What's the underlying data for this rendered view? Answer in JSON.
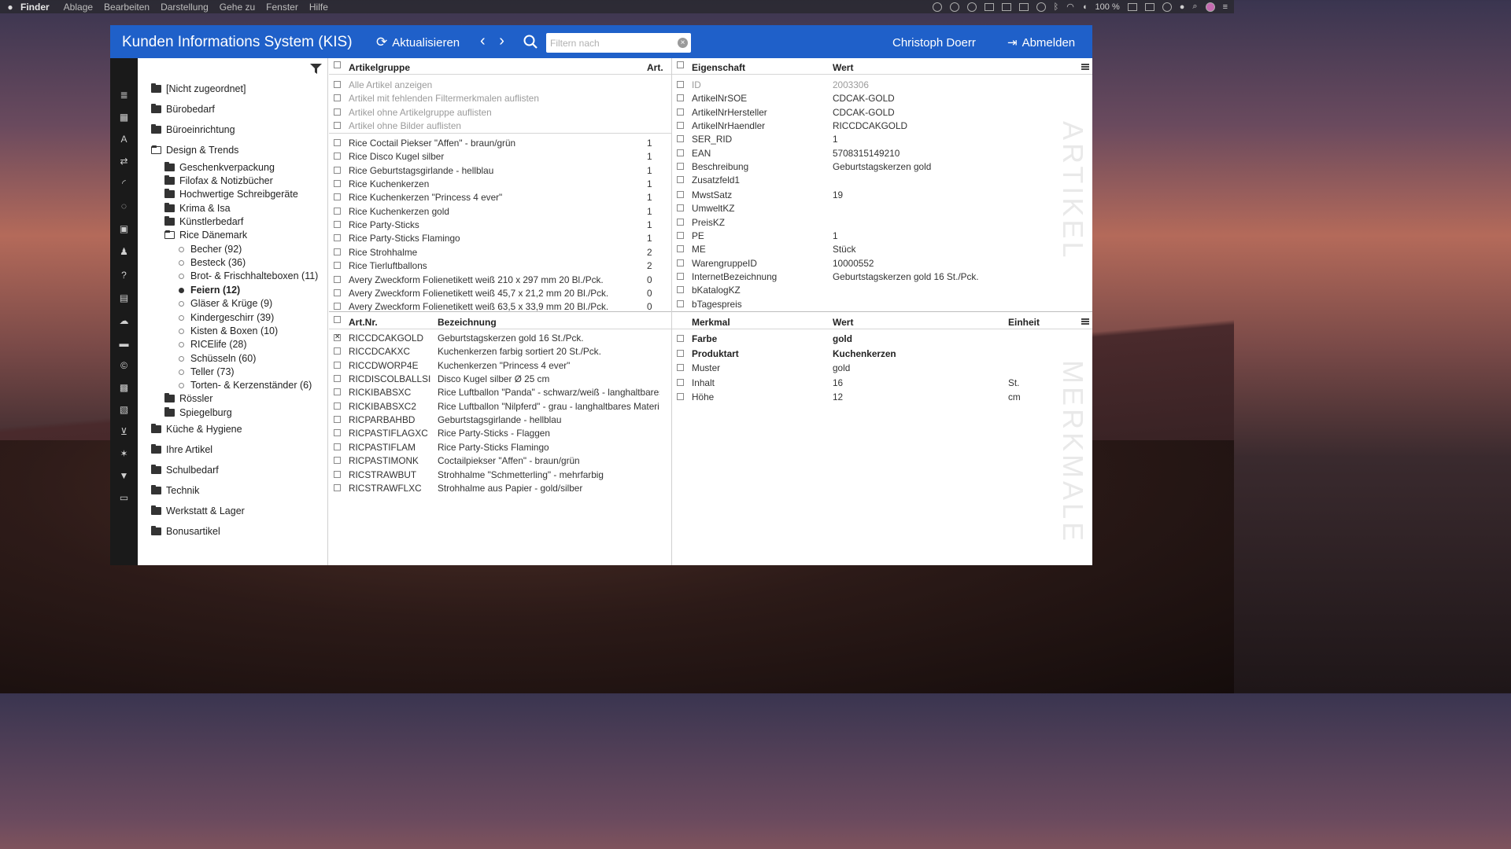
{
  "menubar": {
    "app": "Finder",
    "items": [
      "Ablage",
      "Bearbeiten",
      "Darstellung",
      "Gehe zu",
      "Fenster",
      "Hilfe"
    ],
    "battery": "100 %"
  },
  "header": {
    "title": "Kunden Informations System (KIS)",
    "refresh_label": "Aktualisieren",
    "nav_arrows": "‹ ›",
    "search_placeholder": "Filtern nach",
    "user": "Christoph Doerr",
    "logout_label": "Abmelden",
    "accent": "#1f60c9"
  },
  "tree": {
    "top": [
      "[Nicht zugeordnet]",
      "Bürobedarf",
      "Büroeinrichtung",
      "Design & Trends"
    ],
    "design_children": [
      "Geschenkverpackung",
      "Filofax & Notizbücher",
      "Hochwertige Schreibgeräte",
      "Krima & Isa",
      "Künstlerbedarf",
      "Rice Dänemark"
    ],
    "rice_children": [
      "Becher (92)",
      "Besteck (36)",
      "Brot- & Frischhaltebox­en (11)",
      "Feiern (12)",
      "Gläser & Krüge (9)",
      "Kindergeschirr (39)",
      "Kisten & Boxen (10)",
      "RICElife (28)",
      "Schüsseln (60)",
      "Teller (73)",
      "Torten- & Kerzenständer (6)"
    ],
    "design_children_after": [
      "Rössler",
      "Spiegelburg"
    ],
    "bottom": [
      "Küche & Hygiene",
      "Ihre Artikel",
      "Schulbedarf",
      "Technik",
      "Werkstatt & Lager",
      "Bonusartikel"
    ]
  },
  "artikelgruppe": {
    "col1": "Artikelgruppe",
    "col2": "Art.",
    "special": [
      "Alle Artikel anzeigen",
      "Artikel mit fehlenden Filtermerkmalen auflisten",
      "Artikel ohne Artikelgruppe auflisten",
      "Artikel ohne Bilder auflisten"
    ],
    "rows": [
      {
        "name": "Rice Coctail Piekser \"Affen\" - braun/grün",
        "count": "1"
      },
      {
        "name": "Rice Disco Kugel silber",
        "count": "1"
      },
      {
        "name": "Rice Geburtstagsgirlande - hellblau",
        "count": "1"
      },
      {
        "name": "Rice Kuchenkerzen",
        "count": "1"
      },
      {
        "name": "Rice Kuchenkerzen \"Princess 4 ever\"",
        "count": "1"
      },
      {
        "name": "Rice Kuchenkerzen gold",
        "count": "1"
      },
      {
        "name": "Rice Party-Sticks",
        "count": "1"
      },
      {
        "name": "Rice Party-Sticks Flamingo",
        "count": "1"
      },
      {
        "name": "Rice Strohhalme",
        "count": "2"
      },
      {
        "name": "Rice Tierluftballons",
        "count": "2"
      },
      {
        "name": "Avery Zweckform Folienetikett weiß 210 x 297 mm 20 Bl./Pck.",
        "count": "0"
      },
      {
        "name": "Avery Zweckform Folienetikett weiß 45,7 x 21,2 mm 20 Bl./Pck.",
        "count": "0"
      },
      {
        "name": "Avery Zweckform Folienetikett weiß 63,5 x 33,9 mm 20 Bl./Pck.",
        "count": "0"
      }
    ]
  },
  "artikel": {
    "col1": "Art.Nr.",
    "col2": "Bezeichnung",
    "rows": [
      {
        "nr": "RICCDCAKGOLD",
        "name": "Geburtstagskerzen gold 16 St./Pck.",
        "checked": true
      },
      {
        "nr": "RICCDCAKXC",
        "name": "Kuchenkerzen farbig sortiert 20 St./Pck.",
        "checked": false
      },
      {
        "nr": "RICCDWORP4E",
        "name": "Kuchenkerzen \"Princess 4 ever\"",
        "checked": false
      },
      {
        "nr": "RICDISCOLBALLSI",
        "name": "Disco Kugel silber Ø 25 cm",
        "checked": false
      },
      {
        "nr": "RICKIBABSXC",
        "name": "Rice Luftballon \"Panda\" - schwarz/weiß - langhaltbares M",
        "checked": false
      },
      {
        "nr": "RICKIBABSXC2",
        "name": "Rice Luftballon \"Nilpferd\" - grau - langhaltbares Material",
        "checked": false
      },
      {
        "nr": "RICPARBAHBD",
        "name": "Geburtstagsgirlande - hellblau",
        "checked": false
      },
      {
        "nr": "RICPASTIFLAGXC",
        "name": "Rice Party-Sticks - Flaggen",
        "checked": false
      },
      {
        "nr": "RICPASTIFLAM",
        "name": "Rice Party-Sticks Flamingo",
        "checked": false
      },
      {
        "nr": "RICPASTIMONK",
        "name": "Coctailpiekser \"Affen\" - braun/grün",
        "checked": false
      },
      {
        "nr": "RICSTRAWBUT",
        "name": "Strohhalme \"Schmetterling\" - mehrfarbig",
        "checked": false
      },
      {
        "nr": "RICSTRAWFLXC",
        "name": "Strohhalme aus Papier - gold/silber",
        "checked": false
      }
    ]
  },
  "eigenschaft": {
    "col1": "Eigenschaft",
    "col2": "Wert",
    "watermark": "ARTIKEL",
    "rows": [
      {
        "k": "ID",
        "v": "2003306",
        "muted": true
      },
      {
        "k": "ArtikelNrSOE",
        "v": "CDCAK-GOLD"
      },
      {
        "k": "ArtikelNrHersteller",
        "v": "CDCAK-GOLD"
      },
      {
        "k": "ArtikelNrHaendler",
        "v": "RICCDCAKGOLD"
      },
      {
        "k": "SER_RID",
        "v": "1"
      },
      {
        "k": "EAN",
        "v": "5708315149210"
      },
      {
        "k": "Beschreibung",
        "v": "Geburtstagskerzen gold"
      },
      {
        "k": "Zusatzfeld1",
        "v": ""
      },
      {
        "k": "MwstSatz",
        "v": "19"
      },
      {
        "k": "UmweltKZ",
        "v": ""
      },
      {
        "k": "PreisKZ",
        "v": ""
      },
      {
        "k": "PE",
        "v": "1"
      },
      {
        "k": "ME",
        "v": "Stück"
      },
      {
        "k": "WarengruppeID",
        "v": "10000552"
      },
      {
        "k": "InternetBezeichnung",
        "v": "Geburtstagskerzen gold 16 St./Pck."
      },
      {
        "k": "bKatalogKZ",
        "v": ""
      },
      {
        "k": "bTagespreis",
        "v": ""
      }
    ]
  },
  "merkmal": {
    "col1": "Merkmal",
    "col2": "Wert",
    "col3": "Einheit",
    "watermark": "MERKMALE",
    "rows": [
      {
        "k": "Farbe",
        "v": "gold",
        "u": "",
        "bold": true
      },
      {
        "k": "Produktart",
        "v": "Kuchenkerzen",
        "u": "",
        "bold": true
      },
      {
        "k": "Muster",
        "v": "gold",
        "u": ""
      },
      {
        "k": "Inhalt",
        "v": "16",
        "u": "St."
      },
      {
        "k": "Höhe",
        "v": "12",
        "u": "cm"
      }
    ]
  }
}
